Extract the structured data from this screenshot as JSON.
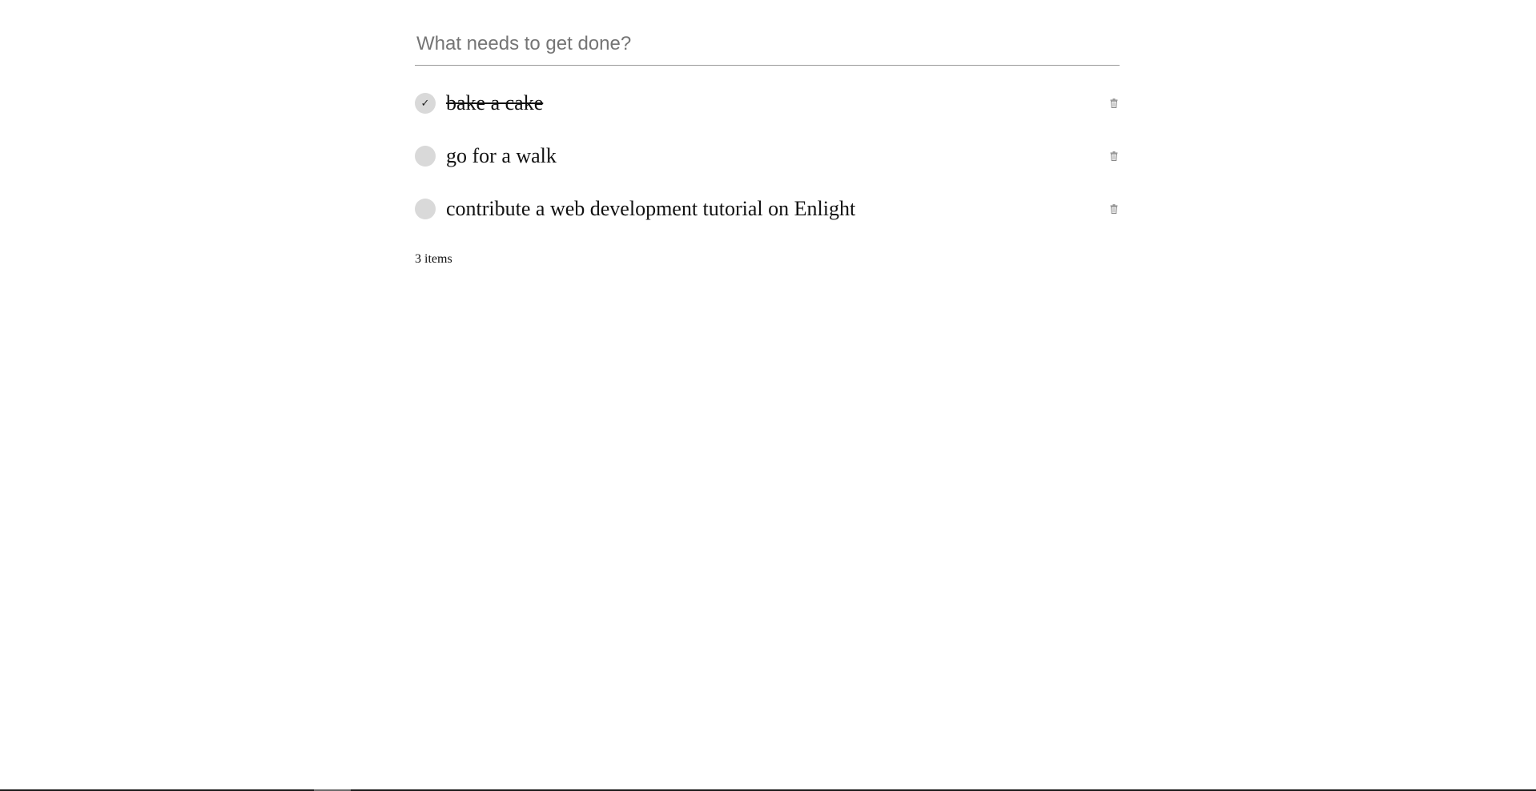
{
  "new_todo": {
    "placeholder": "What needs to get done?",
    "value": ""
  },
  "todos": [
    {
      "label": "bake a cake",
      "completed": true,
      "check_glyph": "✓",
      "delete_icon": "trash-icon"
    },
    {
      "label": "go for a walk",
      "completed": false,
      "check_glyph": "",
      "delete_icon": "trash-icon"
    },
    {
      "label": "contribute a web development tutorial on Enlight",
      "completed": false,
      "check_glyph": "",
      "delete_icon": "trash-icon"
    }
  ],
  "footer": {
    "count_text": "3 items"
  },
  "colors": {
    "toggle_bg": "#d9d9d9",
    "input_border": "#9a9a9a",
    "placeholder": "#757575",
    "trash_icon": "#8a8a8a"
  }
}
